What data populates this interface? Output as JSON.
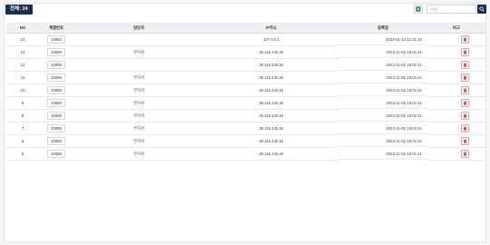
{
  "toolbar": {
    "total_label": "전체: 24",
    "search_placeholder": "이름",
    "excel_icon": "excel-download-icon",
    "search_icon": "search-icon"
  },
  "colors": {
    "primary": "#1d2c53",
    "excel_green": "#1e7b45",
    "delete_red": "#d94b4b"
  },
  "table": {
    "headers": [
      "NO",
      "체결번호",
      "담당자",
      "IP주소",
      "등록일",
      "비고"
    ],
    "rows": [
      {
        "no": "14",
        "number": "10063",
        "manager": "",
        "ip": "127.0.0.1",
        "date": "2022-01-13 12:21:10"
      },
      {
        "no": "13",
        "number": "10069",
        "manager": "부가서",
        "ip": "39.115.145.34",
        "date": "2022-11-02 18:01:41"
      },
      {
        "no": "12",
        "number": "10069",
        "manager": "",
        "ip": "39.115.145.34",
        "date": "2022-11-02 18:01:41"
      },
      {
        "no": "11",
        "number": "10068",
        "manager": "부가서",
        "ip": "39.115.145.34",
        "date": "2022-11-02 18:01:41"
      },
      {
        "no": "10",
        "number": "10069",
        "manager": "부가서",
        "ip": "39.115.145.34",
        "date": "2022-11-02 18:01:41"
      },
      {
        "no": "9",
        "number": "10069",
        "manager": "부가서",
        "ip": "39.115.145.34",
        "date": "2022-11-02 18:01:41"
      },
      {
        "no": "8",
        "number": "10069",
        "manager": "부가서",
        "ip": "39.115.145.34",
        "date": "2022-11-02 18:01:41"
      },
      {
        "no": "7",
        "number": "10069",
        "manager": "부가서",
        "ip": "39.115.145.34",
        "date": "2022-11-02 18:01:41"
      },
      {
        "no": "6",
        "number": "10068",
        "manager": "부가서",
        "ip": "39.115.145.34",
        "date": "2022-11-02 18:01:41"
      },
      {
        "no": "5",
        "number": "10068",
        "manager": "부가서",
        "ip": "39.115.145.34",
        "date": "2022-11-02 18:01:41"
      }
    ],
    "row_action_icon": "trash-icon"
  }
}
